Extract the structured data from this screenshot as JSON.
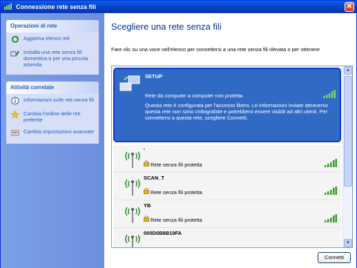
{
  "window": {
    "title": "Connessione rete senza fili",
    "close_symbol": "✕"
  },
  "sidebar": {
    "sections": [
      {
        "title": "Operazioni di rete",
        "items": [
          {
            "label": "Aggiorna elenco reti",
            "icon": "refresh-icon"
          },
          {
            "label": "Installa una rete senza fili domestica o per una piccola azienda",
            "icon": "network-setup-icon"
          }
        ]
      },
      {
        "title": "Attività correlate",
        "items": [
          {
            "label": "Informazioni sulle reti senza fili",
            "icon": "info-icon"
          },
          {
            "label": "Cambia l'ordine delle reti preferite",
            "icon": "star-icon"
          },
          {
            "label": "Cambia impostazioni avanzate",
            "icon": "settings-icon"
          }
        ]
      }
    ]
  },
  "main": {
    "heading": "Scegliere una rete senza fili",
    "instructions": "Fare clic su una voce nell'elenco per connettersi a una rete senza fili rilevata o per ottenere",
    "networks": [
      {
        "name": "SETUP",
        "type": "Rete da computer a computer non protetta",
        "description": "Questa rete è configurata per l'accesso libero. Le informazioni inviate attraverso questa rete non sono crittografate e potrebbero essere visibili ad altri utenti. Per connettersi a questa rete, scegliere Connetti.",
        "selected": true
      },
      {
        "name": "'",
        "type": "Rete senza fili protetta",
        "selected": false
      },
      {
        "name": "SCAN_T",
        "type": "Rete senza fili protetta",
        "selected": false
      },
      {
        "name": "YB",
        "type": "Rete senza fili protetta",
        "selected": false
      },
      {
        "name": "000D0B8B19FA",
        "type": "",
        "selected": false
      }
    ],
    "connect_button": "Connetti"
  },
  "colors": {
    "titlebar": "#0845c7",
    "sidebar": "#7aa1e6",
    "selection": "#316ac5",
    "link": "#215dc6",
    "heading": "#003399"
  }
}
